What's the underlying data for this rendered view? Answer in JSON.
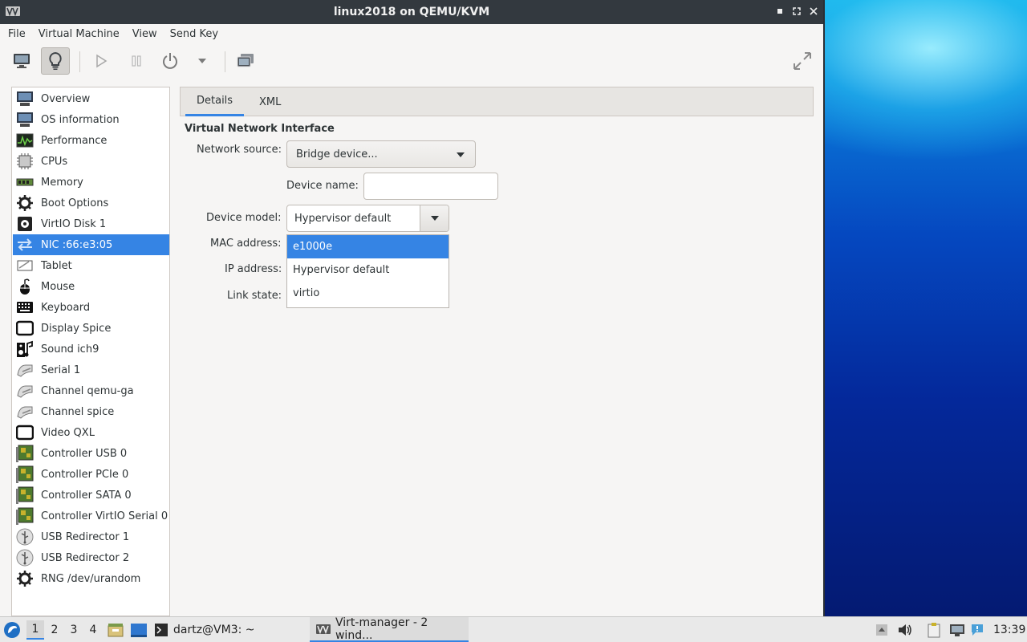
{
  "window": {
    "title": "linux2018 on QEMU/KVM",
    "controls": {
      "minimize": "▪",
      "maximize": "⤢",
      "close": "✕"
    }
  },
  "menubar": {
    "items": [
      "File",
      "Virtual Machine",
      "View",
      "Send Key"
    ]
  },
  "sidebar": {
    "items": [
      {
        "label": "Overview",
        "icon": "monitor-icon"
      },
      {
        "label": "OS information",
        "icon": "monitor-icon"
      },
      {
        "label": "Performance",
        "icon": "performance-graph-icon"
      },
      {
        "label": "CPUs",
        "icon": "cpu-chip-icon"
      },
      {
        "label": "Memory",
        "icon": "memory-module-icon"
      },
      {
        "label": "Boot Options",
        "icon": "gear-icon"
      },
      {
        "label": "VirtIO Disk 1",
        "icon": "disk-icon"
      },
      {
        "label": "NIC :66:e3:05",
        "icon": "network-arrows-icon",
        "selected": true
      },
      {
        "label": "Tablet",
        "icon": "tablet-icon"
      },
      {
        "label": "Mouse",
        "icon": "mouse-icon"
      },
      {
        "label": "Keyboard",
        "icon": "keyboard-icon"
      },
      {
        "label": "Display Spice",
        "icon": "display-icon"
      },
      {
        "label": "Sound ich9",
        "icon": "sound-icon"
      },
      {
        "label": "Serial 1",
        "icon": "serial-cable-icon"
      },
      {
        "label": "Channel qemu-ga",
        "icon": "serial-cable-icon"
      },
      {
        "label": "Channel spice",
        "icon": "serial-cable-icon"
      },
      {
        "label": "Video QXL",
        "icon": "display-icon"
      },
      {
        "label": "Controller USB 0",
        "icon": "controller-card-icon"
      },
      {
        "label": "Controller PCIe 0",
        "icon": "controller-card-icon"
      },
      {
        "label": "Controller SATA 0",
        "icon": "controller-card-icon"
      },
      {
        "label": "Controller VirtIO Serial 0",
        "icon": "controller-card-icon"
      },
      {
        "label": "USB Redirector 1",
        "icon": "usb-icon"
      },
      {
        "label": "USB Redirector 2",
        "icon": "usb-icon"
      },
      {
        "label": "RNG /dev/urandom",
        "icon": "gear-icon"
      }
    ]
  },
  "tabs": [
    {
      "label": "Details",
      "active": true
    },
    {
      "label": "XML",
      "active": false
    }
  ],
  "details": {
    "section_title": "Virtual Network Interface",
    "network_source_label": "Network source:",
    "network_source_value": "Bridge device...",
    "device_name_label": "Device name:",
    "device_name_value": "",
    "device_model_label": "Device model:",
    "device_model_value": "Hypervisor default",
    "mac_address_label": "MAC address:",
    "ip_address_label": "IP address:",
    "link_state_label": "Link state:",
    "device_model_options": [
      "e1000e",
      "Hypervisor default",
      "virtio"
    ],
    "highlighted_option": "e1000e"
  },
  "taskbar": {
    "workspaces": [
      "1",
      "2",
      "3",
      "4"
    ],
    "current_workspace": "1",
    "terminal_task": "dartz@VM3: ~",
    "virtmanager_task": "Virt-manager - 2 wind...",
    "clock": "13:39"
  },
  "colors": {
    "accent": "#3584e4",
    "titlebar": "#33393f"
  }
}
